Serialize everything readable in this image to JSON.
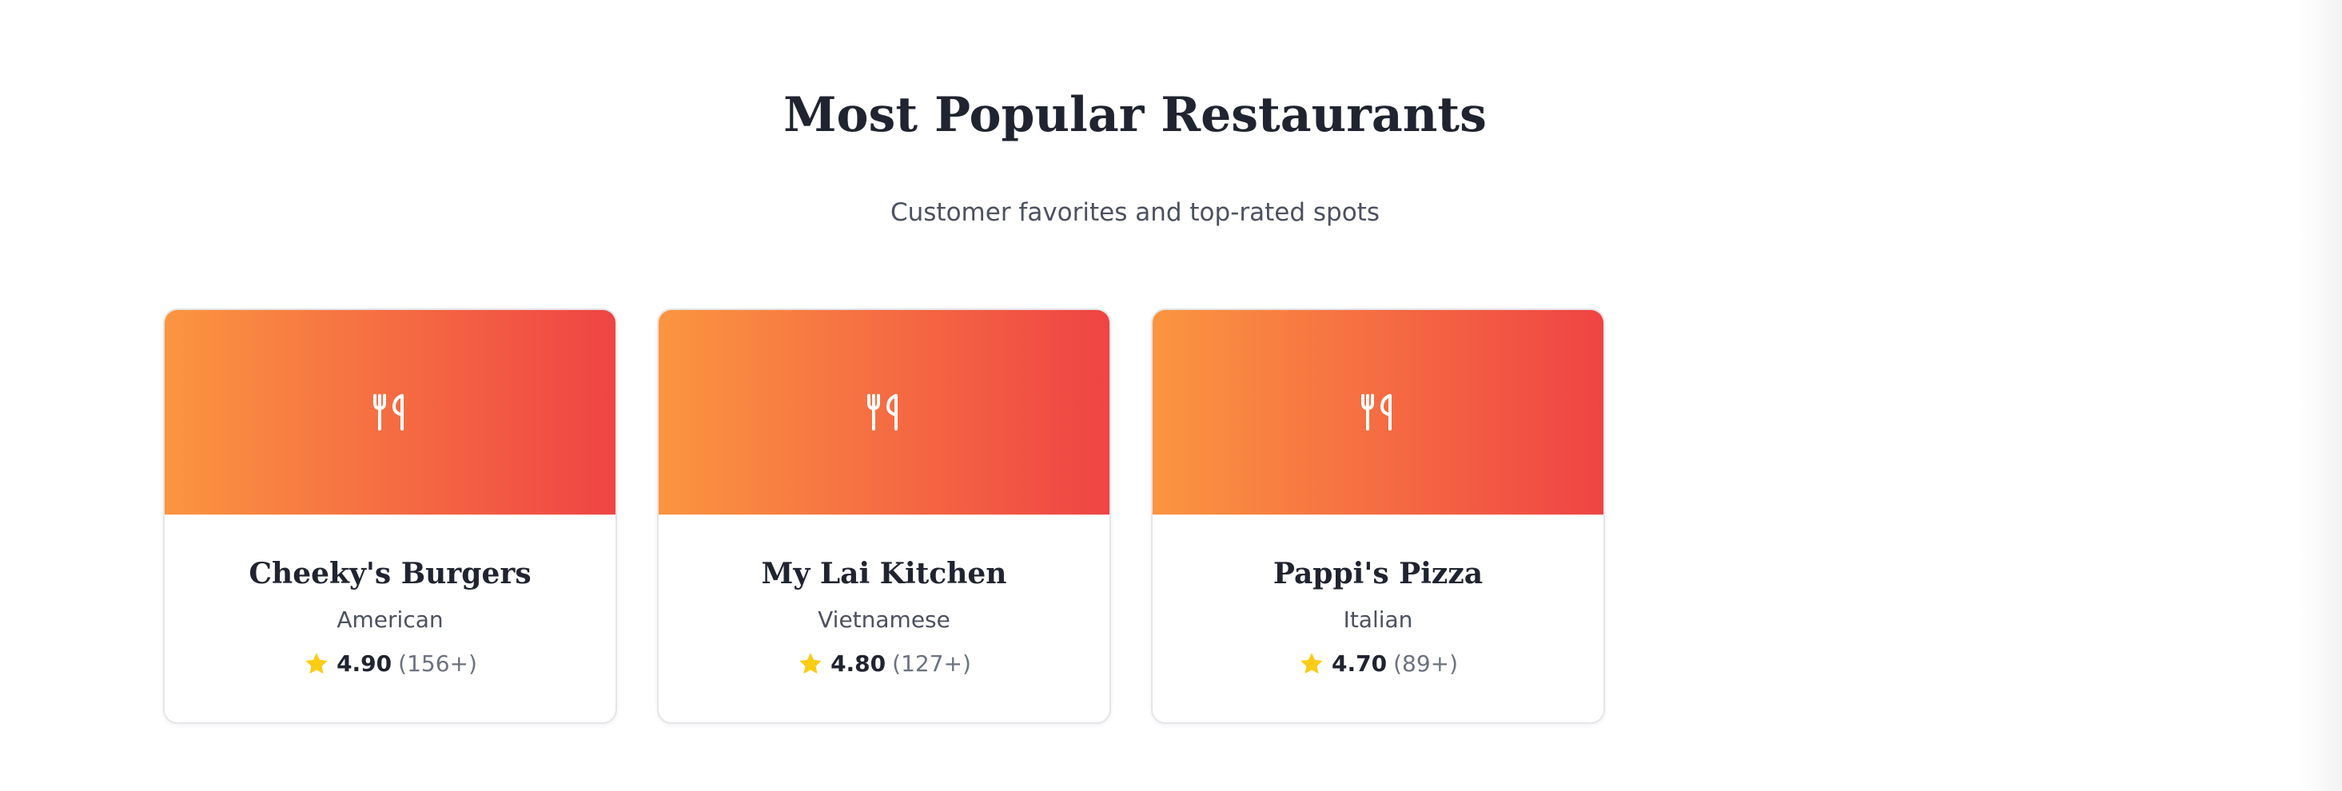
{
  "section": {
    "title": "Most Popular Restaurants",
    "subtitle": "Customer favorites and top-rated spots"
  },
  "colors": {
    "banner_gradient_start": "#fb9540",
    "banner_gradient_end": "#ef4444",
    "star": "#facc15"
  },
  "restaurants": [
    {
      "name": "Cheeky's Burgers",
      "cuisine": "American",
      "rating": "4.90",
      "reviews": "(156+)",
      "icon": "utensils-icon"
    },
    {
      "name": "My Lai Kitchen",
      "cuisine": "Vietnamese",
      "rating": "4.80",
      "reviews": "(127+)",
      "icon": "utensils-icon"
    },
    {
      "name": "Pappi's Pizza",
      "cuisine": "Italian",
      "rating": "4.70",
      "reviews": "(89+)",
      "icon": "utensils-icon"
    }
  ]
}
